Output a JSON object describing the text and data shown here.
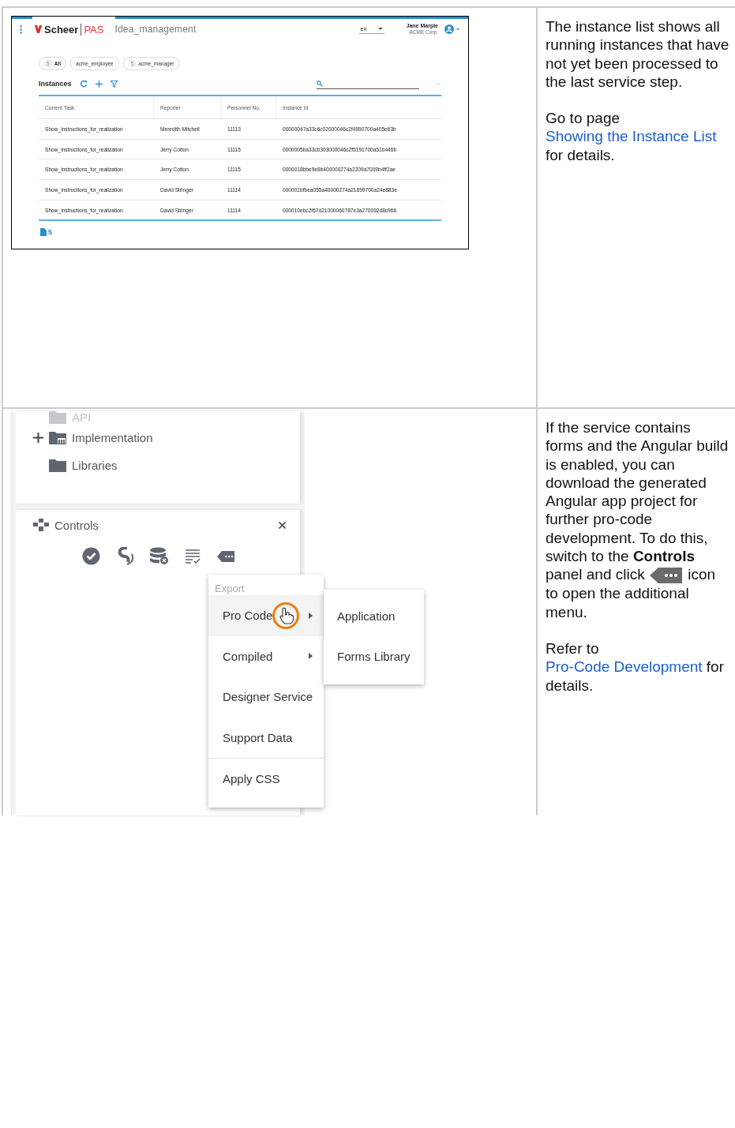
{
  "rows": [
    {
      "instance_app": {
        "brand": "Scheer",
        "product": "PAS",
        "app_title": "Idea_management",
        "language": "en",
        "user_name": "Jane Marple",
        "user_company": "ACME Corp.",
        "filters": [
          {
            "count": "5",
            "label": "All",
            "selected": true
          },
          {
            "label": "acme_employee",
            "selected": false
          },
          {
            "count": "5",
            "label": "acme_manager",
            "selected": false
          }
        ],
        "section_title": "Instances",
        "table": {
          "columns": [
            "Current Task",
            "Reporter",
            "Personnel No.",
            "Instance Id"
          ],
          "rows": [
            [
              "Show_instructions_for_realization",
              "Meredith Mitchell",
              "11113",
              "00000047a33c6c02000046c2f4990700a405e63b"
            ],
            [
              "Show_instructions_for_realization",
              "Jerry Cotton",
              "11115",
              "0000005ba33cb303000046c2f5191700a51b446b"
            ],
            [
              "Show_instructions_for_realization",
              "Jerry Cotton",
              "11115",
              "0000018bbe9e8b400000274a2209a7009b4ff2ae"
            ],
            [
              "Show_instructions_for_realization",
              "David Stringer",
              "11114",
              "000001bfbea055a40000274a21899700a24e883e"
            ],
            [
              "Show_instructions_for_realization",
              "David Stringer",
              "11114",
              "000010ebc2f67d21000060787e3a270092d8c966"
            ]
          ]
        },
        "footer_count": "5"
      },
      "description": [
        [
          {
            "kind": "text",
            "text": "The instance list shows all running instances that have not yet been processed to the last service step."
          }
        ],
        [
          {
            "kind": "text",
            "text": "Go to page "
          },
          {
            "kind": "link",
            "text": "Showing the Instance List"
          },
          {
            "kind": "text",
            "text": " for details."
          }
        ]
      ]
    },
    {
      "designer": {
        "tree": [
          {
            "label": "API",
            "expandable": false,
            "faded": true
          },
          {
            "label": "Implementation",
            "expandable": true,
            "faded": false
          },
          {
            "label": "Libraries",
            "expandable": false,
            "faded": false
          }
        ],
        "panel_title": "Controls",
        "menu": {
          "section_label": "Export",
          "items": [
            {
              "label": "Pro Code",
              "submenu": true,
              "selected": true,
              "divider_before": false
            },
            {
              "label": "Compiled",
              "submenu": true,
              "selected": false,
              "divider_before": false
            },
            {
              "label": "Designer Service",
              "submenu": false,
              "selected": false,
              "divider_before": false
            },
            {
              "label": "Support Data",
              "submenu": false,
              "selected": false,
              "divider_before": false
            },
            {
              "label": "Apply CSS",
              "submenu": false,
              "selected": false,
              "divider_before": true
            }
          ],
          "submenu": [
            "Application",
            "Forms Library"
          ]
        }
      },
      "description": [
        [
          {
            "kind": "text",
            "text": "If the service contains forms and the Angular build is enabled, you can download the generated Angular app project for further pro-code development. To do this, switch to the **Controls** panel and click "
          },
          {
            "kind": "icon"
          },
          {
            "kind": "text",
            "text": " icon to open the additional menu."
          }
        ],
        [
          {
            "kind": "text",
            "text": "Refer to "
          },
          {
            "kind": "link",
            "text": "Pro-Code Development"
          },
          {
            "kind": "text",
            "text": " for details."
          }
        ]
      ]
    }
  ]
}
